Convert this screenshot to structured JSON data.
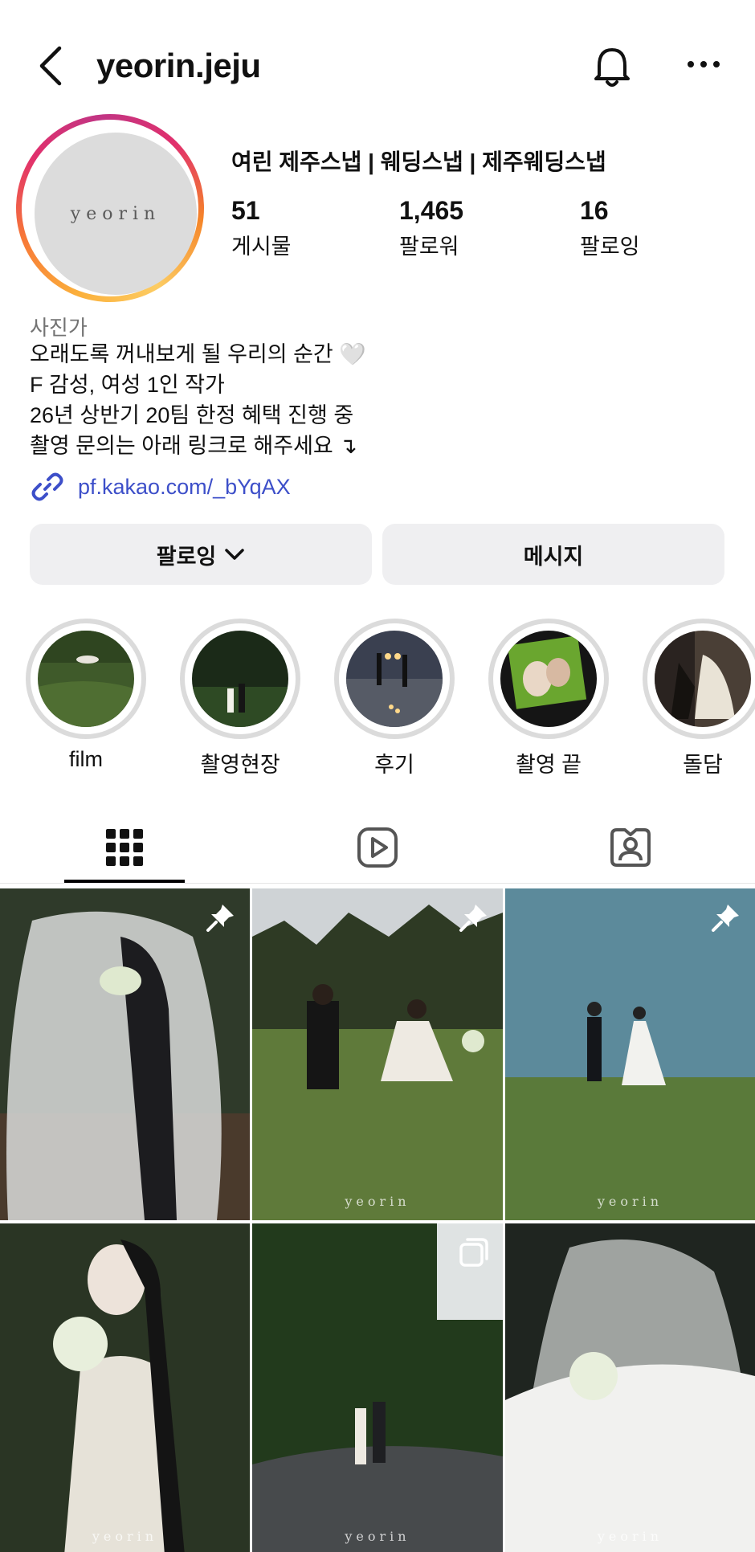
{
  "header": {
    "username": "yeorin.jeju"
  },
  "profile": {
    "avatar_text": "yeorin",
    "display_name": "여린  제주스냅 | 웨딩스냅 | 제주웨딩스냅",
    "stats": [
      {
        "value": "51",
        "label": "게시물"
      },
      {
        "value": "1,465",
        "label": "팔로워"
      },
      {
        "value": "16",
        "label": "팔로잉"
      }
    ],
    "category": "사진가",
    "bio_lines": [
      "오래도록 꺼내보게 될 우리의 순간 🤍",
      "F 감성, 여성 1인 작가",
      "26년 상반기 20팀 한정 혜택 진행 중",
      "촬영 문의는 아래 링크로 해주세요 ↴"
    ],
    "link": "pf.kakao.com/_bYqAX"
  },
  "actions": {
    "following_label": "팔로잉",
    "message_label": "메시지"
  },
  "highlights": [
    {
      "label": "film",
      "icon": "grass-field-photo"
    },
    {
      "label": "촬영현장",
      "icon": "couple-at-night-photo"
    },
    {
      "label": "후기",
      "icon": "sparkler-beach-photo"
    },
    {
      "label": "촬영 끝",
      "icon": "print-photo"
    },
    {
      "label": "돌담",
      "icon": "bride-dress-photo"
    }
  ],
  "tabs": [
    {
      "name": "grid-icon",
      "active": true
    },
    {
      "name": "reels-icon",
      "active": false
    },
    {
      "name": "tagged-icon",
      "active": false
    }
  ],
  "grid": [
    {
      "name": "veil-couple-photo",
      "badge": "pin",
      "watermark": ""
    },
    {
      "name": "couple-running-field-photo",
      "badge": "pin",
      "watermark": "yeorin"
    },
    {
      "name": "couple-seaside-photo",
      "badge": "pin",
      "watermark": "yeorin"
    },
    {
      "name": "bride-bouquet-photo",
      "badge": "",
      "watermark": "yeorin"
    },
    {
      "name": "couple-forest-road-photo",
      "badge": "reel",
      "watermark": "yeorin"
    },
    {
      "name": "bride-veil-tulle-photo",
      "badge": "",
      "watermark": "yeorin"
    }
  ],
  "colors": {
    "link": "#3d4fc9",
    "button_bg": "#efeff1",
    "muted": "#737373"
  }
}
